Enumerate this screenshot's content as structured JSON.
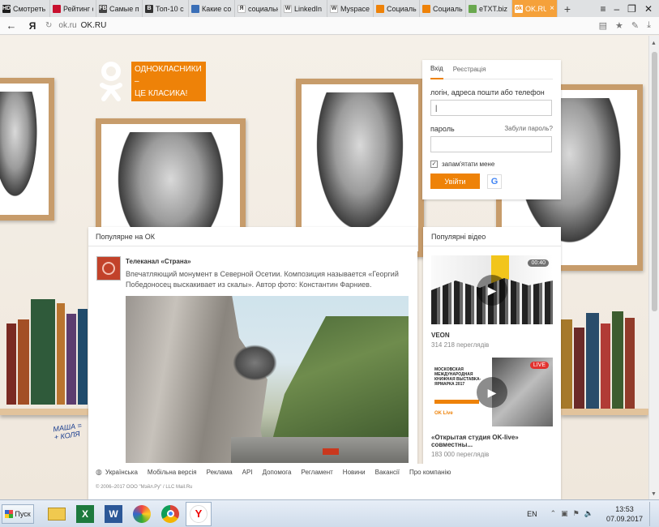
{
  "browser": {
    "tabs": [
      {
        "label": "Смотреть",
        "fav_text": "HD",
        "fav_color": "#1b1b1b"
      },
      {
        "label": "Рейтинг с",
        "fav_text": "",
        "fav_color": "#c8102e"
      },
      {
        "label": "Самые по",
        "fav_text": "FB",
        "fav_color": "#444444"
      },
      {
        "label": "Топ-10 с",
        "fav_text": "B",
        "fav_color": "#333333"
      },
      {
        "label": "Какие со",
        "fav_text": "",
        "fav_color": "#3a6fb7"
      },
      {
        "label": "социальн",
        "fav_text": "Я",
        "fav_color": "#ffffff"
      },
      {
        "label": "LinkedIn",
        "fav_text": "W",
        "fav_color": "#ffffff"
      },
      {
        "label": "Myspace",
        "fav_text": "W",
        "fav_color": "#ffffff"
      },
      {
        "label": "Социальн",
        "fav_text": "",
        "fav_color": "#ee8208"
      },
      {
        "label": "Социальн",
        "fav_text": "",
        "fav_color": "#ee8208"
      },
      {
        "label": "eTXT.biz",
        "fav_text": "",
        "fav_color": "#6aa84f"
      }
    ],
    "active_tab": {
      "label": "OK.RU",
      "close": "×"
    },
    "new_tab": "+",
    "window_controls": [
      "≡",
      "–",
      "❐",
      "✕"
    ],
    "back": "←",
    "yandex_button": "Я",
    "reload": "↻",
    "url_domain": "ok.ru",
    "url_title": "OK.RU",
    "addr_icons": [
      "▤",
      "★",
      "✎",
      "⤓"
    ]
  },
  "brand": {
    "slogan_line1": "ОДНОКЛАСНИКИ –",
    "slogan_line2": "ЦЕ КЛАСИКА!",
    "accent": "#ee8208"
  },
  "login": {
    "tabs": [
      "Вхід",
      "Реєстрація"
    ],
    "login_label": "логін, адреса пошти або телефон",
    "login_value": "|",
    "password_label": "пароль",
    "forgot": "Забули пароль?",
    "remember": "запам'ятати мене",
    "remember_check": "✓",
    "enter_button": "Увійти",
    "google_glyph": "G"
  },
  "feed": {
    "title": "Популярне на ОК",
    "post": {
      "author": "Телеканал «Страна»",
      "text": "Впечатляющий монумент в Северной Осетии. Композиция называется «Георгий Победоносец выскакивает из скалы». Автор фото: Константин Фарниев."
    }
  },
  "videos": {
    "title": "Популярні відео",
    "items": [
      {
        "duration": "00:40",
        "title": "VEON",
        "views": "314 218 переглядів"
      },
      {
        "badge": "LIVE",
        "thumb_text": "МОСКОВСКАЯ МЕЖДУНАРОДНАЯ КНИЖНАЯ ВЫСТАВКА-ЯРМАРКА 2017",
        "thumb_logo": "OK Live",
        "title": "«Открытая студия OK-live» совместны...",
        "views": "183 000 переглядів"
      }
    ],
    "play_glyph": "▶"
  },
  "footer": {
    "globe": "◍",
    "links": [
      "Українська",
      "Мобільна версія",
      "Реклама",
      "API",
      "Допомога",
      "Регламент",
      "Новини",
      "Вакансії",
      "Про компанію"
    ],
    "copyright": "© 2006–2017 ООО \"Мэйл.Ру\" / LLC Mail.Ru"
  },
  "page_art": {
    "signature_line1": "МАША =",
    "signature_line2": "+ КОЛЯ"
  },
  "scrollbar": {
    "up": "▲",
    "down": "▼"
  },
  "taskbar": {
    "start_label": "Пуск",
    "excel_glyph": "X",
    "word_glyph": "W",
    "yandex_glyph": "Y",
    "lang": "EN",
    "tray_icons": [
      "⌃",
      "▣",
      "⚑",
      "🔈"
    ],
    "time": "13:53",
    "date": "07.09.2017"
  }
}
